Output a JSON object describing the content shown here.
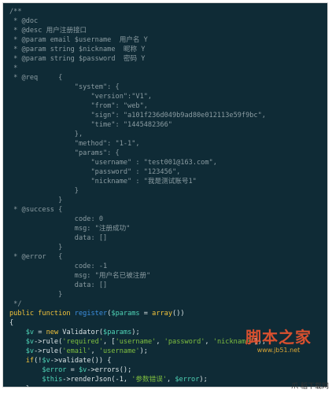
{
  "lines": [
    [
      {
        "t": "/**",
        "c": "cm"
      }
    ],
    [
      {
        "t": " * @doc",
        "c": "cm"
      }
    ],
    [
      {
        "t": " * @desc 用户注册接口",
        "c": "cm"
      }
    ],
    [
      {
        "t": " * @param email $username  用户名 Y",
        "c": "cm"
      }
    ],
    [
      {
        "t": " * @param string $nickname  昵称 Y",
        "c": "cm"
      }
    ],
    [
      {
        "t": " * @param string $password  密码 Y",
        "c": "cm"
      }
    ],
    [
      {
        "t": " *",
        "c": "cm"
      }
    ],
    [
      {
        "t": " * @req     {",
        "c": "cm"
      }
    ],
    [
      {
        "t": "                \"system\": {",
        "c": "cm"
      }
    ],
    [
      {
        "t": "                    \"version\":\"V1\",",
        "c": "cm"
      }
    ],
    [
      {
        "t": "                    \"from\": \"web\",",
        "c": "cm"
      }
    ],
    [
      {
        "t": "                    \"sign\": \"a101f236d049b9ad80e012113e59f9bc\",",
        "c": "cm"
      }
    ],
    [
      {
        "t": "                    \"time\": \"1445482366\"",
        "c": "cm"
      }
    ],
    [
      {
        "t": "                },",
        "c": "cm"
      }
    ],
    [
      {
        "t": "                \"method\": \"1-1\",",
        "c": "cm"
      }
    ],
    [
      {
        "t": "                \"params\": {",
        "c": "cm"
      }
    ],
    [
      {
        "t": "                    \"username\" : \"test001@163.com\",",
        "c": "cm"
      }
    ],
    [
      {
        "t": "                    \"password\" : \"123456\",",
        "c": "cm"
      }
    ],
    [
      {
        "t": "                    \"nickname\" : \"我是测试账号1\"",
        "c": "cm"
      }
    ],
    [
      {
        "t": "                }",
        "c": "cm"
      }
    ],
    [
      {
        "t": "            }",
        "c": "cm"
      }
    ],
    [
      {
        "t": " * @success {",
        "c": "cm"
      }
    ],
    [
      {
        "t": "                code: 0",
        "c": "cm"
      }
    ],
    [
      {
        "t": "                msg: \"注册成功\"",
        "c": "cm"
      }
    ],
    [
      {
        "t": "                data: []",
        "c": "cm"
      }
    ],
    [
      {
        "t": "            }",
        "c": "cm"
      }
    ],
    [
      {
        "t": " * @error   {",
        "c": "cm"
      }
    ],
    [
      {
        "t": "                code: -1",
        "c": "cm"
      }
    ],
    [
      {
        "t": "                msg: \"用户名已被注册\"",
        "c": "cm"
      }
    ],
    [
      {
        "t": "                data: []",
        "c": "cm"
      }
    ],
    [
      {
        "t": "            }",
        "c": "cm"
      }
    ],
    [
      {
        "t": " */",
        "c": "cm"
      }
    ],
    [
      {
        "t": "public function ",
        "c": "kw"
      },
      {
        "t": "register",
        "c": "fn"
      },
      {
        "t": "(",
        "c": "pl"
      },
      {
        "t": "$params",
        "c": "var"
      },
      {
        "t": " = ",
        "c": "pl"
      },
      {
        "t": "array",
        "c": "kw"
      },
      {
        "t": "())",
        "c": "pl"
      }
    ],
    [
      {
        "t": "{",
        "c": "pl"
      }
    ],
    [
      {
        "t": "    ",
        "c": "pl"
      },
      {
        "t": "$v",
        "c": "var"
      },
      {
        "t": " = ",
        "c": "pl"
      },
      {
        "t": "new",
        "c": "kw"
      },
      {
        "t": " Validator(",
        "c": "pl"
      },
      {
        "t": "$params",
        "c": "var"
      },
      {
        "t": ");",
        "c": "pl"
      }
    ],
    [
      {
        "t": "    ",
        "c": "pl"
      },
      {
        "t": "$v",
        "c": "var"
      },
      {
        "t": "->rule(",
        "c": "pl"
      },
      {
        "t": "'required'",
        "c": "sq"
      },
      {
        "t": ", [",
        "c": "pl"
      },
      {
        "t": "'username'",
        "c": "sq"
      },
      {
        "t": ", ",
        "c": "pl"
      },
      {
        "t": "'password'",
        "c": "sq"
      },
      {
        "t": ", ",
        "c": "pl"
      },
      {
        "t": "'nickname'",
        "c": "sq"
      },
      {
        "t": "]);",
        "c": "pl"
      }
    ],
    [
      {
        "t": "    ",
        "c": "pl"
      },
      {
        "t": "$v",
        "c": "var"
      },
      {
        "t": "->rule(",
        "c": "pl"
      },
      {
        "t": "'email'",
        "c": "sq"
      },
      {
        "t": ", ",
        "c": "pl"
      },
      {
        "t": "'username'",
        "c": "sq"
      },
      {
        "t": ");",
        "c": "pl"
      }
    ],
    [
      {
        "t": "    ",
        "c": "pl"
      },
      {
        "t": "if",
        "c": "kw"
      },
      {
        "t": "(!",
        "c": "pl"
      },
      {
        "t": "$v",
        "c": "var"
      },
      {
        "t": "->validate()) {",
        "c": "pl"
      }
    ],
    [
      {
        "t": "        ",
        "c": "pl"
      },
      {
        "t": "$error",
        "c": "var"
      },
      {
        "t": " = ",
        "c": "pl"
      },
      {
        "t": "$v",
        "c": "var"
      },
      {
        "t": "->errors();",
        "c": "pl"
      }
    ],
    [
      {
        "t": "        ",
        "c": "pl"
      },
      {
        "t": "$this",
        "c": "var"
      },
      {
        "t": "->renderJson(-1, ",
        "c": "pl"
      },
      {
        "t": "'参数错误'",
        "c": "sq"
      },
      {
        "t": ", ",
        "c": "pl"
      },
      {
        "t": "$error",
        "c": "var"
      },
      {
        "t": ");",
        "c": "pl"
      }
    ],
    [
      {
        "t": "    }",
        "c": "pl"
      }
    ]
  ],
  "watermark": {
    "main": "脚本之家",
    "url": "www.jb51.net"
  },
  "site_label": "爪 稻下载网"
}
